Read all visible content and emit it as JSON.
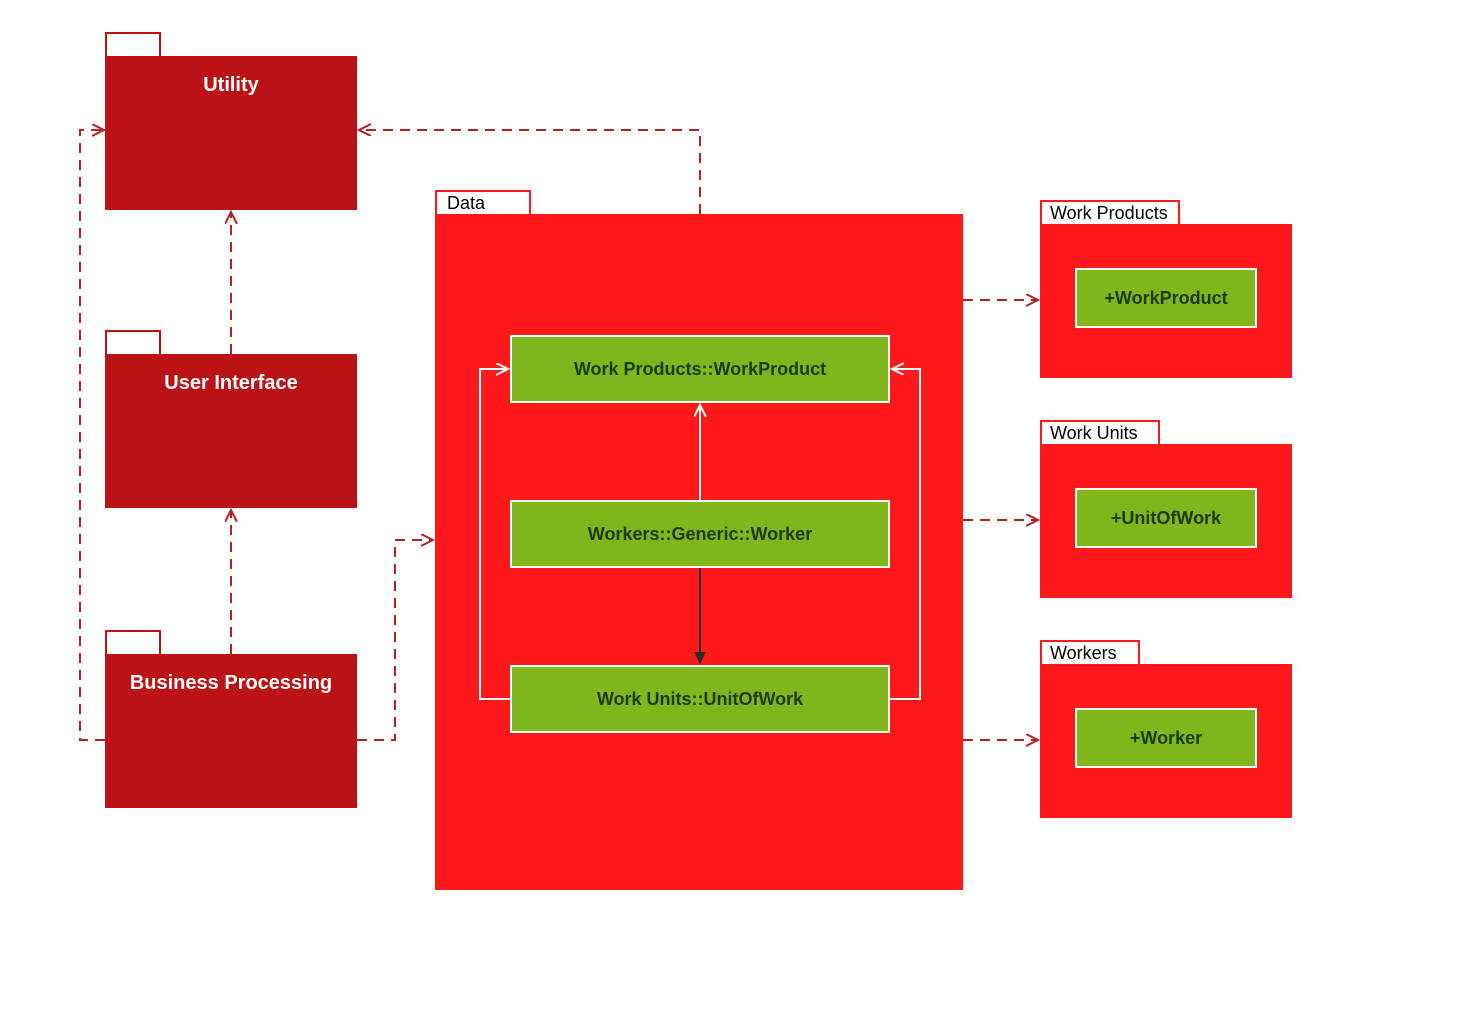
{
  "colors": {
    "package_dark": "#bb1315",
    "package_bright": "#ff1919",
    "class_green": "#7eb61b",
    "dash_line": "#b12223"
  },
  "packages": {
    "utility": {
      "label": "Utility"
    },
    "user_interface": {
      "label": "User Interface"
    },
    "business_processing": {
      "label": "Business Processing"
    },
    "data": {
      "label": "Data"
    },
    "work_products": {
      "label": "Work Products",
      "inner_class": "+WorkProduct"
    },
    "work_units": {
      "label": "Work Units",
      "inner_class": "+UnitOfWork"
    },
    "workers": {
      "label": "Workers",
      "inner_class": "+Worker"
    }
  },
  "data_classes": {
    "work_products_workproduct": "Work Products::WorkProduct",
    "workers_generic_worker": "Workers::Generic::Worker",
    "work_units_unitofwork": "Work Units::UnitOfWork"
  }
}
